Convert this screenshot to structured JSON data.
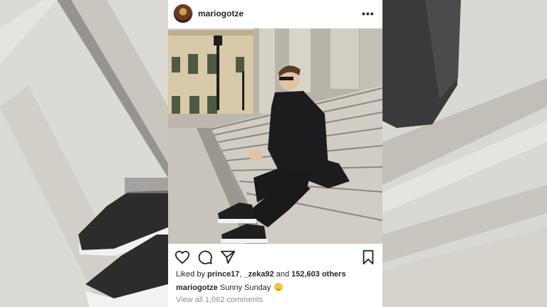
{
  "post": {
    "username": "mariogotze",
    "more_icon": "more-options-icon",
    "likes_prefix": "Liked by",
    "liked_user_1": "prince17",
    "separator": ",",
    "liked_user_2": "_zeka92",
    "likes_and": "and",
    "likes_count": "152,603 others",
    "caption_user": "mariogotze",
    "caption_text": "Sunny Sunday",
    "caption_emoji": "smiling-face-emoji",
    "comments_link": "View all 1,062 comments"
  },
  "actions": {
    "like_icon": "heart-icon",
    "comment_icon": "comment-icon",
    "share_icon": "share-icon",
    "save_icon": "bookmark-icon"
  },
  "colors": {
    "text": "#262626",
    "muted": "#8e8e8e",
    "background": "#ffffff"
  }
}
